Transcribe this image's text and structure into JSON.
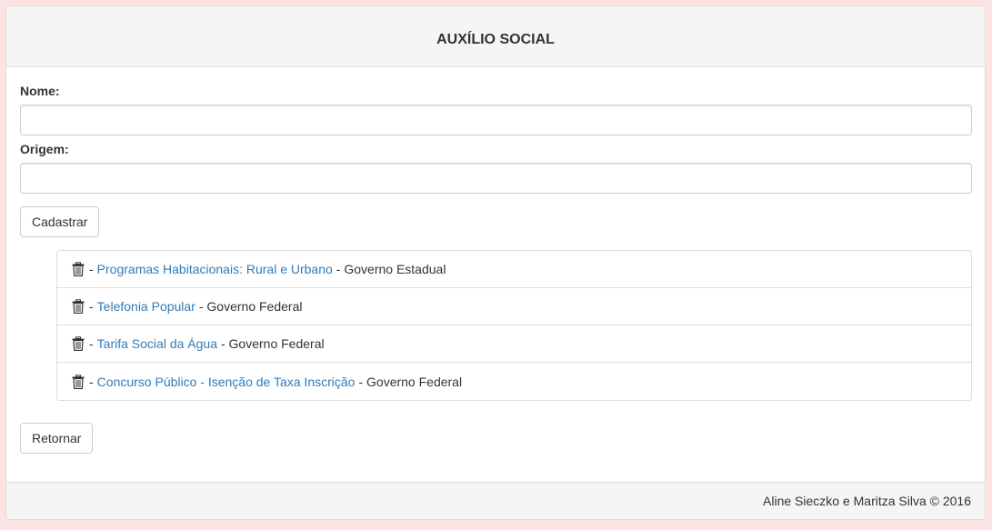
{
  "header": {
    "title": "AUXÍLIO SOCIAL"
  },
  "form": {
    "nome": {
      "label": "Nome:",
      "value": "",
      "placeholder": ""
    },
    "origem": {
      "label": "Origem:",
      "value": "",
      "placeholder": ""
    },
    "submit_label": "Cadastrar"
  },
  "list": {
    "separator": "-",
    "items": [
      {
        "name": "Programas Habitacionais: Rural e Urbano",
        "origin": "Governo Estadual",
        "icon": "trash-icon"
      },
      {
        "name": "Telefonia Popular",
        "origin": "Governo Federal",
        "icon": "trash-icon"
      },
      {
        "name": "Tarifa Social da Água",
        "origin": "Governo Federal",
        "icon": "trash-icon"
      },
      {
        "name": "Concurso Público - Isenção de Taxa Inscrição",
        "origin": "Governo Federal",
        "icon": "trash-icon"
      }
    ]
  },
  "return_label": "Retornar",
  "footer": {
    "text": "Aline Sieczko e Maritza Silva © 2016"
  },
  "colors": {
    "background": "#fde3e3",
    "link": "#337ab7",
    "panel_header": "#f5f5f5",
    "border": "#dddddd"
  }
}
